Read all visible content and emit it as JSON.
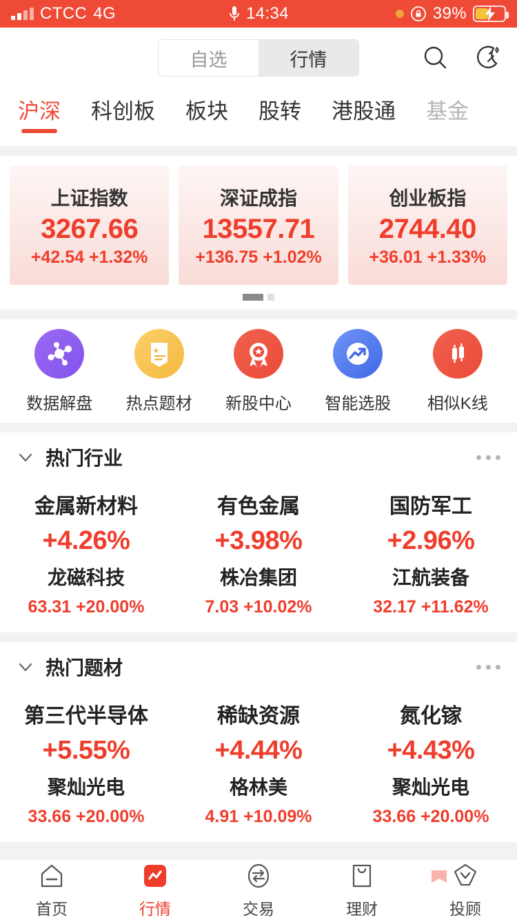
{
  "status_bar": {
    "carrier": "CTCC",
    "network": "4G",
    "time": "14:34",
    "battery_percent": "39%",
    "icons": {
      "signal": "signal-bars-icon",
      "mic": "microphone-icon",
      "dot": "orange-dot-icon",
      "rotation_lock": "rotation-lock-icon",
      "battery": "battery-charging-icon"
    }
  },
  "header": {
    "segments": [
      {
        "label": "自选",
        "active": false
      },
      {
        "label": "行情",
        "active": true
      }
    ],
    "search_icon": "search-icon",
    "night_mode_icon": "moon-night-mode-icon"
  },
  "tabs": [
    {
      "label": "沪深",
      "active": true
    },
    {
      "label": "科创板",
      "active": false
    },
    {
      "label": "板块",
      "active": false
    },
    {
      "label": "股转",
      "active": false
    },
    {
      "label": "港股通",
      "active": false
    },
    {
      "label": "基金",
      "active": false
    }
  ],
  "indices": [
    {
      "name": "上证指数",
      "value": "3267.66",
      "change": "+42.54 +1.32%"
    },
    {
      "name": "深证成指",
      "value": "13557.71",
      "change": "+136.75 +1.02%"
    },
    {
      "name": "创业板指",
      "value": "2744.40",
      "change": "+36.01 +1.33%"
    }
  ],
  "pager": {
    "pages": 2,
    "active": 0
  },
  "quick_actions": [
    {
      "label": "数据解盘",
      "icon": "molecule-network-icon",
      "color": "#8b56ee"
    },
    {
      "label": "热点题材",
      "icon": "document-bookmark-icon",
      "color": "#f5b83f"
    },
    {
      "label": "新股中心",
      "icon": "medal-award-icon",
      "color": "#ea4a38"
    },
    {
      "label": "智能选股",
      "icon": "trending-up-arrow-icon",
      "color": "#4169e8"
    },
    {
      "label": "相似K线",
      "icon": "candlestick-icon",
      "color": "#ea4a38"
    }
  ],
  "sections": [
    {
      "title": "热门行业",
      "collapse_icon": "chevron-down-icon",
      "more_icon": "ellipsis-icon",
      "items": [
        {
          "name": "金属新材料",
          "pct": "+4.26%",
          "stock": "龙磁科技",
          "sub": "63.31 +20.00%"
        },
        {
          "name": "有色金属",
          "pct": "+3.98%",
          "stock": "株冶集团",
          "sub": "7.03 +10.02%"
        },
        {
          "name": "国防军工",
          "pct": "+2.96%",
          "stock": "江航装备",
          "sub": "32.17 +11.62%"
        }
      ]
    },
    {
      "title": "热门题材",
      "collapse_icon": "chevron-down-icon",
      "more_icon": "ellipsis-icon",
      "items": [
        {
          "name": "第三代半导体",
          "pct": "+5.55%",
          "stock": "聚灿光电",
          "sub": "33.66 +20.00%"
        },
        {
          "name": "稀缺资源",
          "pct": "+4.44%",
          "stock": "格林美",
          "sub": "4.91 +10.09%"
        },
        {
          "name": "氮化镓",
          "pct": "+4.43%",
          "stock": "聚灿光电",
          "sub": "33.66 +20.00%"
        }
      ]
    }
  ],
  "bottom_nav": [
    {
      "label": "首页",
      "icon": "home-icon",
      "active": false
    },
    {
      "label": "行情",
      "icon": "quotes-icon",
      "active": true
    },
    {
      "label": "交易",
      "icon": "trade-swap-icon",
      "active": false
    },
    {
      "label": "理财",
      "icon": "wallet-icon",
      "active": false
    },
    {
      "label": "投顾",
      "icon": "advisor-icon",
      "active": false
    }
  ],
  "colors": {
    "brand_red": "#ee4a36",
    "up_red": "#ef3d2c",
    "status_bar": "#ee4a36",
    "page_bg": "#f2f2f2"
  }
}
